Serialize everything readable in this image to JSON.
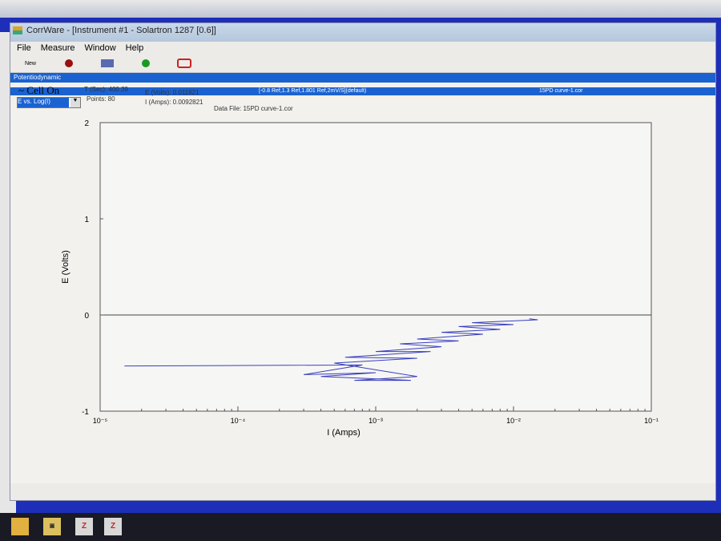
{
  "window": {
    "title": "CorrWare - [Instrument #1 - Solartron 1287 [0.6]]"
  },
  "menu": [
    "File",
    "Measure",
    "Window",
    "Help"
  ],
  "toolbar": {
    "new_label": "New",
    "icons": [
      "new-icon",
      "record-icon",
      "sequence-icon",
      "cell-on-icon",
      "cell-switch-icon"
    ]
  },
  "child": {
    "title": "Potentiodynamic",
    "segment": "[-0.8 Ref,1.3 Ref,1.801 Ref,2mV/S](default)",
    "file_tab": "15PD curve-1.cor"
  },
  "status": {
    "cell": "Cell On",
    "plot_type": "E vs. Log(I)",
    "time": "T (Sec): 400.39",
    "points": "Points: 80",
    "e": "E (Volts): 0.011821",
    "i": "I (Amps): 0.0092821",
    "data_file": "Data File: 15PD curve-1.cor"
  },
  "chart_data": {
    "type": "line",
    "xscale": "log",
    "xlabel": "I (Amps)",
    "ylabel": "E (Volts)",
    "xlim": [
      1e-05,
      0.1
    ],
    "ylim": [
      -1,
      2
    ],
    "xticks": [
      "10⁻⁵",
      "10⁻⁴",
      "10⁻³",
      "10⁻²",
      "10⁻¹"
    ],
    "yticks": [
      "-1",
      "0",
      "1",
      "2"
    ],
    "series": [
      {
        "name": "15PD curve-1.cor",
        "color": "#3a3fc0",
        "points": [
          [
            1.5e-05,
            -0.53
          ],
          [
            0.0008,
            -0.52
          ],
          [
            0.0003,
            -0.62
          ],
          [
            0.001,
            -0.6
          ],
          [
            0.0004,
            -0.64
          ],
          [
            0.0018,
            -0.68
          ],
          [
            0.0007,
            -0.68
          ],
          [
            0.002,
            -0.64
          ],
          [
            0.0005,
            -0.5
          ],
          [
            0.002,
            -0.45
          ],
          [
            0.0006,
            -0.44
          ],
          [
            0.0025,
            -0.38
          ],
          [
            0.001,
            -0.38
          ],
          [
            0.003,
            -0.33
          ],
          [
            0.0015,
            -0.3
          ],
          [
            0.004,
            -0.27
          ],
          [
            0.002,
            -0.25
          ],
          [
            0.006,
            -0.2
          ],
          [
            0.003,
            -0.18
          ],
          [
            0.008,
            -0.15
          ],
          [
            0.004,
            -0.12
          ],
          [
            0.01,
            -0.1
          ],
          [
            0.005,
            -0.08
          ],
          [
            0.015,
            -0.05
          ],
          [
            0.013,
            -0.04
          ]
        ]
      }
    ]
  }
}
